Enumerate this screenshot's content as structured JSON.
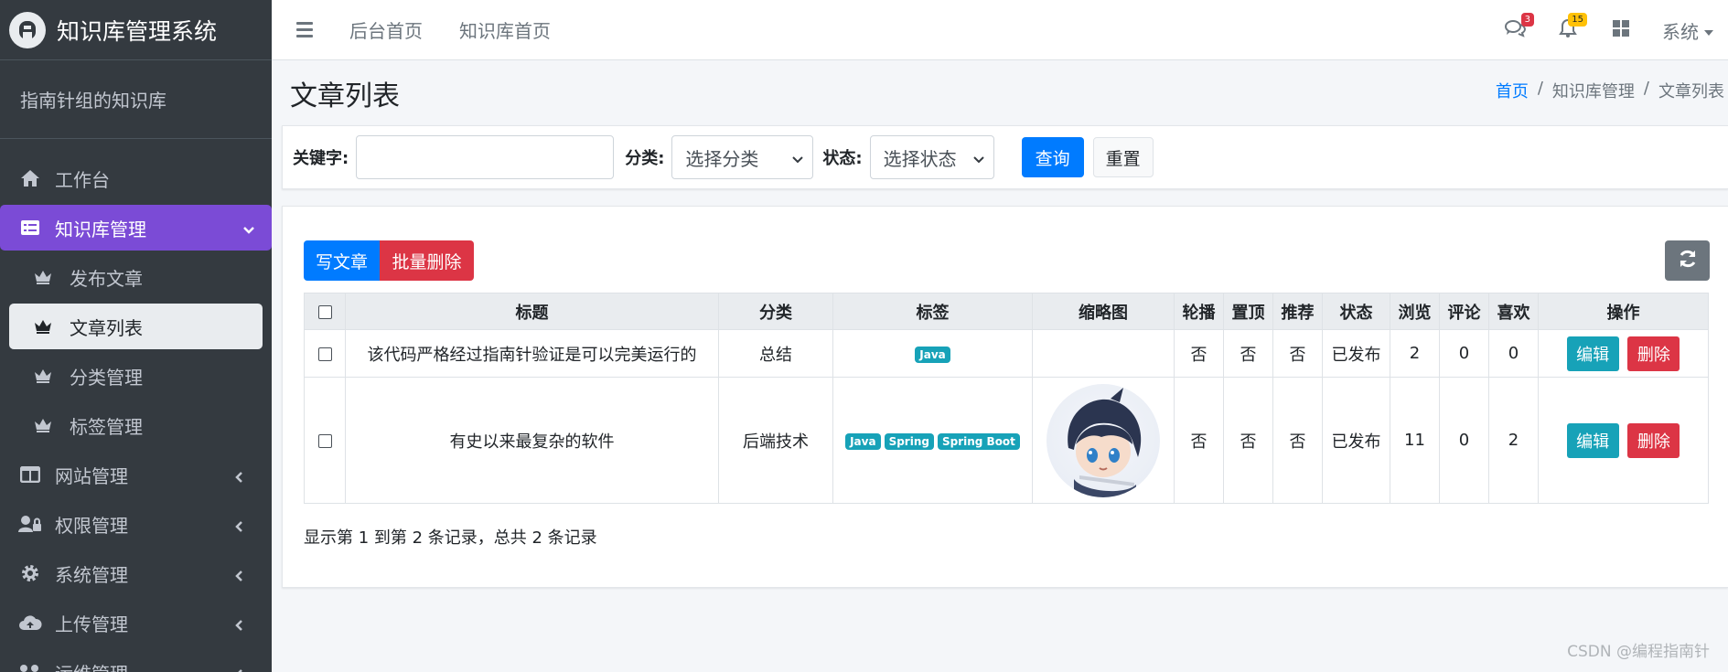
{
  "brand": {
    "title": "知识库管理系统",
    "logo_letter": "A"
  },
  "user_panel": {
    "name": "指南针组的知识库"
  },
  "sidebar": {
    "items": [
      {
        "label": "工作台",
        "icon": "home-icon"
      },
      {
        "label": "知识库管理",
        "icon": "list-icon",
        "active": true
      },
      {
        "label": "网站管理",
        "icon": "columns-icon"
      },
      {
        "label": "权限管理",
        "icon": "user-lock-icon"
      },
      {
        "label": "系统管理",
        "icon": "gear-icon"
      },
      {
        "label": "上传管理",
        "icon": "cloud-upload-icon"
      },
      {
        "label": "运维管理",
        "icon": "ops-icon"
      }
    ],
    "sub_items": [
      {
        "label": "发布文章",
        "icon": "crown-icon"
      },
      {
        "label": "文章列表",
        "icon": "crown-icon",
        "current": true
      },
      {
        "label": "分类管理",
        "icon": "crown-icon"
      },
      {
        "label": "标签管理",
        "icon": "crown-icon"
      }
    ]
  },
  "topbar": {
    "links": [
      "后台首页",
      "知识库首页"
    ],
    "messages_count": "3",
    "notifications_count": "15",
    "system_label": "系统"
  },
  "header": {
    "title": "文章列表",
    "breadcrumb": [
      "首页",
      "/",
      "知识库管理",
      "/",
      "文章列表"
    ]
  },
  "search": {
    "keyword_label": "关键字:",
    "keyword_value": "",
    "category_label": "分类:",
    "category_selected": "选择分类",
    "status_label": "状态:",
    "status_selected": "选择状态",
    "query_button": "查询",
    "reset_button": "重置"
  },
  "toolbar": {
    "write_label": "写文章",
    "batch_delete_label": "批量删除"
  },
  "table": {
    "columns": [
      "标题",
      "分类",
      "标签",
      "缩略图",
      "轮播",
      "置顶",
      "推荐",
      "状态",
      "浏览",
      "评论",
      "喜欢",
      "操作"
    ],
    "rows": [
      {
        "title": "该代码严格经过指南针验证是可以完美运行的",
        "category": "总结",
        "tags": [
          "Java"
        ],
        "carousel": "否",
        "top": "否",
        "recommend": "否",
        "status": "已发布",
        "views": "2",
        "comments": "0",
        "likes": "0",
        "edit": "编辑",
        "delete": "删除"
      },
      {
        "title": "有史以来最复杂的软件",
        "category": "后端技术",
        "tags": [
          "Java",
          "Spring",
          "Spring Boot"
        ],
        "carousel": "否",
        "top": "否",
        "recommend": "否",
        "status": "已发布",
        "views": "11",
        "comments": "0",
        "likes": "2",
        "edit": "编辑",
        "delete": "删除"
      }
    ]
  },
  "pagination": {
    "summary": "显示第 1 到第 2 条记录，总共 2 条记录"
  },
  "watermark": "CSDN @编程指南针",
  "colors": {
    "active_nav": "#7b4bd6",
    "primary": "#007bff",
    "danger": "#dc3545",
    "info": "#17a2b8",
    "sidebar": "#343a40"
  }
}
